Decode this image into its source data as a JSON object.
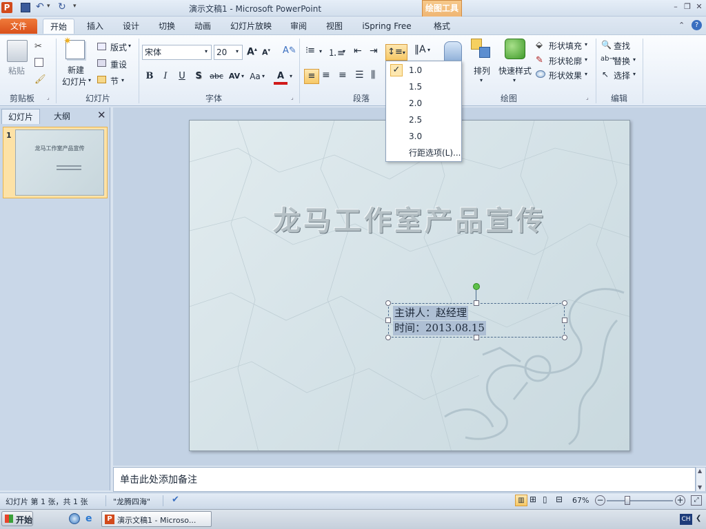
{
  "window": {
    "title": "演示文稿1 - Microsoft PowerPoint",
    "context_group": "绘图工具",
    "app_icon": "P"
  },
  "tabs": [
    {
      "label": "文件"
    },
    {
      "label": "开始"
    },
    {
      "label": "插入"
    },
    {
      "label": "设计"
    },
    {
      "label": "切换"
    },
    {
      "label": "动画"
    },
    {
      "label": "幻灯片放映"
    },
    {
      "label": "审阅"
    },
    {
      "label": "视图"
    },
    {
      "label": "iSpring Free"
    },
    {
      "label": "格式"
    }
  ],
  "ribbon": {
    "clipboard": {
      "paste": "粘贴",
      "group": "剪贴板"
    },
    "slides": {
      "new_slide_1": "新建",
      "new_slide_2": "幻灯片",
      "layout": "版式",
      "reset": "重设",
      "section": "节",
      "group": "幻灯片"
    },
    "font": {
      "family": "宋体",
      "size": "20",
      "group": "字体",
      "bold": "B",
      "italic": "I",
      "underline": "U",
      "shadow": "S",
      "strike": "abc",
      "spacing": "AV",
      "case": "Aa",
      "color": "A"
    },
    "paragraph": {
      "group": "段落"
    },
    "drawing": {
      "arrange": "排列",
      "quick_styles": "快速样式",
      "shape_fill": "形状填充",
      "shape_outline": "形状轮廓",
      "shape_effects": "形状效果",
      "group": "绘图"
    },
    "editing": {
      "find": "查找",
      "replace": "替换",
      "select": "选择",
      "group": "编辑"
    }
  },
  "line_spacing_menu": {
    "items": [
      "1.0",
      "1.5",
      "2.0",
      "2.5",
      "3.0",
      "行距选项(L)..."
    ],
    "checked": "1.0"
  },
  "left_pane": {
    "tabs": [
      "幻灯片",
      "大纲"
    ],
    "slide_number": "1",
    "thumb_title": "龙马工作室产品宣传"
  },
  "slide": {
    "title": "龙马工作室产品宣传",
    "subtitle_line1": "主讲人：赵经理",
    "subtitle_line2": "时间：2013.08.15"
  },
  "notes_placeholder": "单击此处添加备注",
  "status": {
    "slide_info": "幻灯片 第 1 张，共 1 张",
    "theme": "\"龙腾四海\"",
    "zoom": "67%",
    "zoom_level": 0.67
  },
  "taskbar": {
    "start": "开始",
    "window": "演示文稿1 - Microso...",
    "ime": "CH"
  },
  "colors": {
    "file_tab": "#e0642a",
    "context": "#e8a25c",
    "selection": "#aebfd4"
  }
}
